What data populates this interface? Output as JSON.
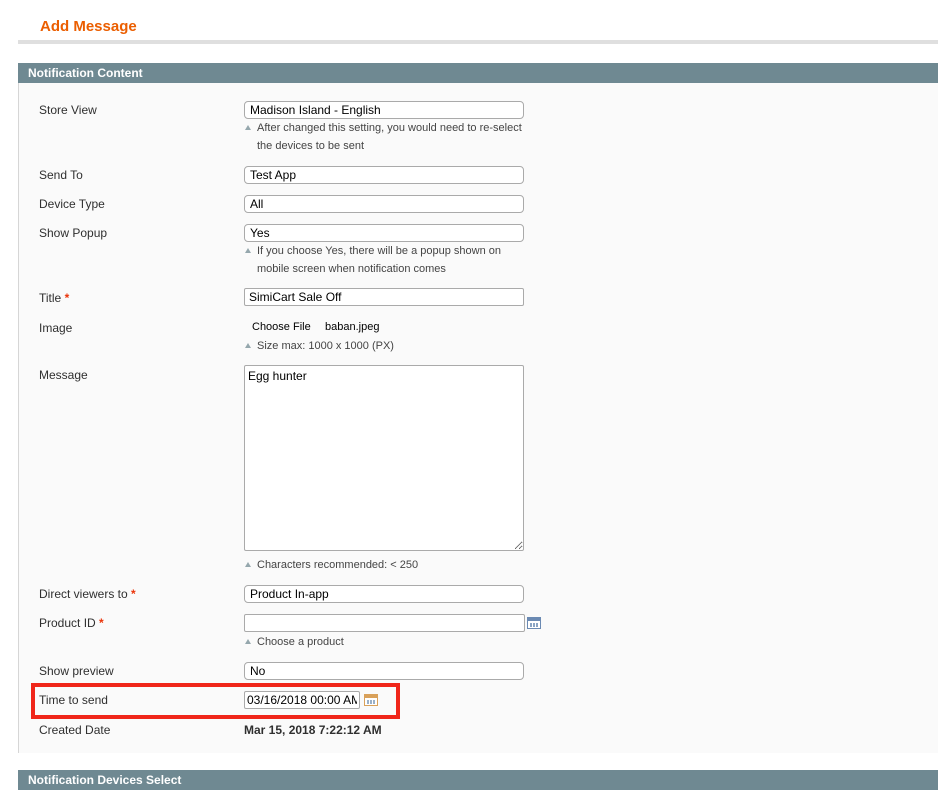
{
  "page": {
    "title": "Add Message"
  },
  "sections": {
    "content_header": "Notification Content",
    "devices_header": "Notification Devices Select"
  },
  "form": {
    "store_view": {
      "label": "Store View",
      "value": "Madison Island - English",
      "note_line1": "After changed this setting, you would need to re-select",
      "note_line2": "the devices to be sent"
    },
    "send_to": {
      "label": "Send To",
      "value": "Test App"
    },
    "device_type": {
      "label": "Device Type",
      "value": "All"
    },
    "show_popup": {
      "label": "Show Popup",
      "value": "Yes",
      "note_line1": "If you choose Yes, there will be a popup shown on",
      "note_line2": "mobile screen when notification comes"
    },
    "title": {
      "label": "Title",
      "required_mark": "*",
      "value": "SimiCart Sale Off"
    },
    "image": {
      "label": "Image",
      "button_label": "Choose File",
      "file_name": "baban.jpeg",
      "note": "Size max: 1000 x 1000 (PX)"
    },
    "message": {
      "label": "Message",
      "value": "Egg hunter",
      "note": "Characters recommended: < 250"
    },
    "direct_viewers": {
      "label": "Direct viewers to",
      "required_mark": "*",
      "value": "Product In-app"
    },
    "product_id": {
      "label": "Product ID",
      "required_mark": "*",
      "value": "",
      "note": "Choose a product"
    },
    "show_preview": {
      "label": "Show preview",
      "value": "No"
    },
    "time_to_send": {
      "label": "Time to send",
      "value": "03/16/2018 00:00 AM"
    },
    "created_date": {
      "label": "Created Date",
      "value": "Mar 15, 2018 7:22:12 AM"
    }
  },
  "icons": {
    "product_picker": "grid-chooser-icon",
    "date_picker": "calendar-icon"
  },
  "colors": {
    "title_orange": "#eb5e00",
    "section_header": "#6f8992",
    "highlight_red": "#f0261a",
    "required_red": "#eb340a"
  }
}
